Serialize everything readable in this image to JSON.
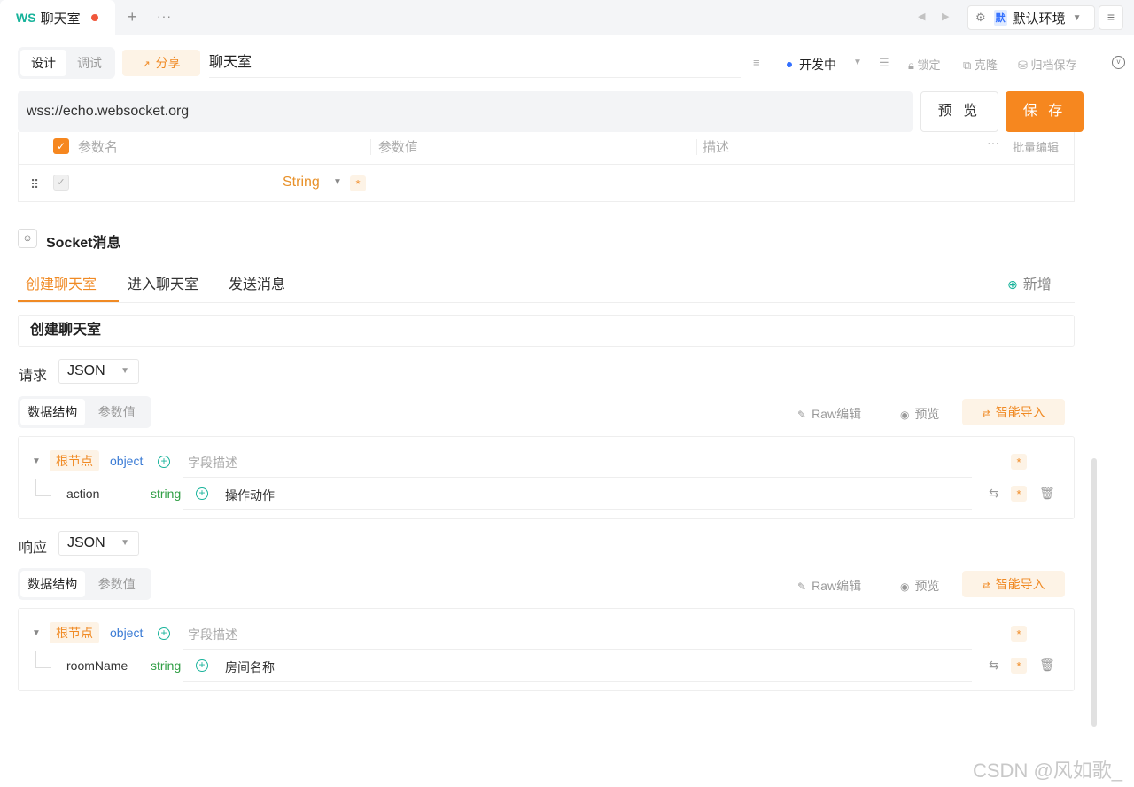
{
  "tabbar": {
    "protocol_tag": "WS",
    "tab_title": "聊天室",
    "add_icon": "+",
    "more_icon": "···",
    "env_badge": "默",
    "env_label": "默认环境",
    "menu_icon": "≡"
  },
  "toolbar": {
    "mode_design": "设计",
    "mode_debug": "调试",
    "share_label": "分享",
    "api_name": "聊天室",
    "status_label": "开发中",
    "lock_label": "锁定",
    "clone_label": "克隆",
    "archive_label": "归档保存"
  },
  "request_bar": {
    "url": "wss://echo.websocket.org",
    "preview_label": "预 览",
    "save_label": "保 存"
  },
  "params_table": {
    "columns": [
      "参数名",
      "参数值",
      "描述"
    ],
    "batch_edit_label": "批量编辑",
    "rows": [
      {
        "name": "",
        "type": "String",
        "value": "",
        "description": ""
      }
    ]
  },
  "socket": {
    "section_title": "Socket消息",
    "tabs": [
      "创建聊天室",
      "进入聊天室",
      "发送消息"
    ],
    "active_tab": 0,
    "add_label": "新增",
    "message_name": "创建聊天室",
    "request": {
      "label": "请求",
      "format": "JSON",
      "view_tabs": [
        "数据结构",
        "参数值"
      ],
      "raw_edit_label": "Raw编辑",
      "preview_label": "预览",
      "smart_import_label": "智能导入",
      "root_label": "根节点",
      "root_type": "object",
      "root_desc_placeholder": "字段描述",
      "fields": [
        {
          "name": "action",
          "type": "string",
          "description": "操作动作"
        }
      ]
    },
    "response": {
      "label": "响应",
      "format": "JSON",
      "view_tabs": [
        "数据结构",
        "参数值"
      ],
      "raw_edit_label": "Raw编辑",
      "preview_label": "预览",
      "smart_import_label": "智能导入",
      "root_label": "根节点",
      "root_type": "object",
      "root_desc_placeholder": "字段描述",
      "fields": [
        {
          "name": "roomName",
          "type": "string",
          "description": "房间名称"
        }
      ]
    }
  },
  "watermark": "CSDN @风如歌_",
  "colors": {
    "accent": "#f6871f",
    "ws_tag": "#18b39b",
    "status_dot": "#3370ff",
    "object_type": "#3a7bd5",
    "string_type": "#2f9e44"
  }
}
